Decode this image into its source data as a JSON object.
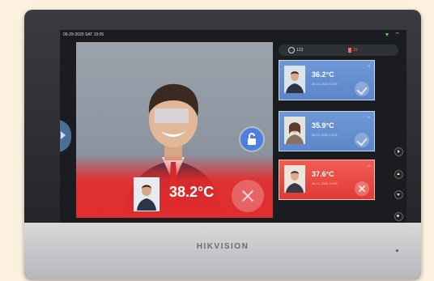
{
  "status_bar": {
    "datetime": "06-29-2020  SAT  19:05",
    "signal_icon": "signal-icon",
    "wifi_icon": "wifi-icon"
  },
  "main": {
    "temperature": "38.2°C",
    "status_color": "#e02d30",
    "lock_icon": "unlock-icon",
    "reject_icon": "close-icon"
  },
  "tabs": [
    {
      "label": "123",
      "icon": "person-icon"
    },
    {
      "label": "15",
      "icon": "alert-icon"
    }
  ],
  "records": [
    {
      "temp": "36.2°C",
      "date": "06-12-2020 19:05",
      "status": "normal",
      "color": "#5b86c8"
    },
    {
      "temp": "35.9°C",
      "date": "06-12-2020 19:04",
      "status": "normal",
      "color": "#5b86c8"
    },
    {
      "temp": "37.6°C",
      "date": "06-12-2020 19:03",
      "status": "abnormal",
      "color": "#e03b36"
    }
  ],
  "brand": "HIKVISION"
}
